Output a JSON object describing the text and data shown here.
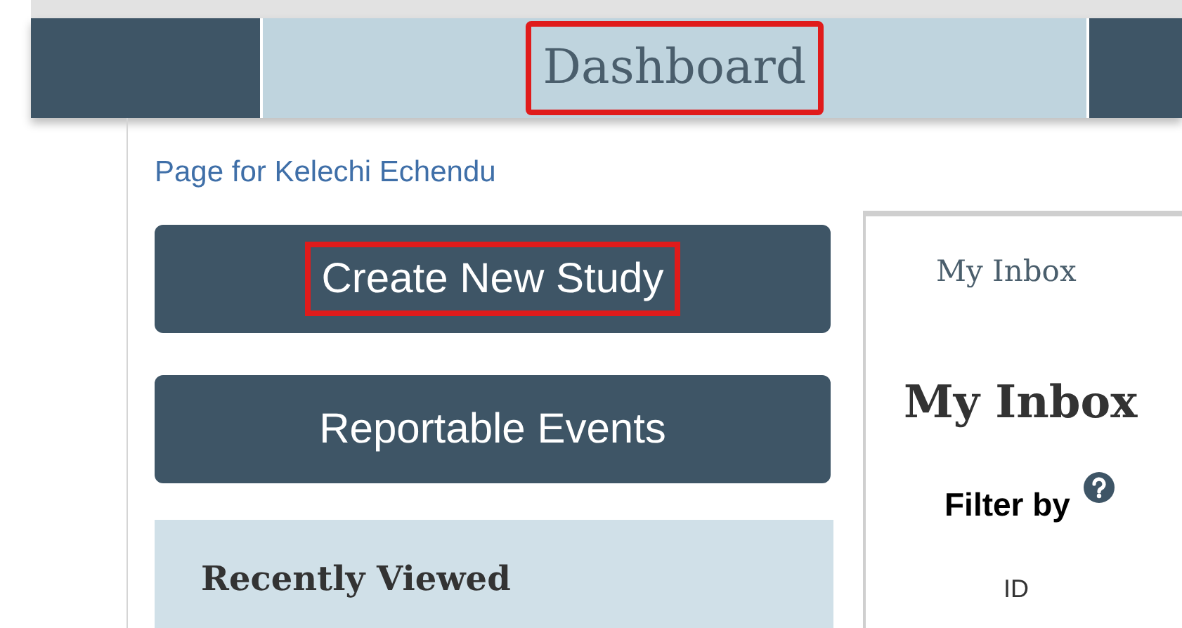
{
  "nav": {
    "tabs": [
      {
        "label": "Dashboard",
        "selected": true,
        "highlighted": true
      }
    ]
  },
  "page_title": "Page for Kelechi Echendu",
  "actions": [
    {
      "label": "Create New Study",
      "highlighted": true
    },
    {
      "label": "Reportable Events",
      "highlighted": false
    }
  ],
  "recently_viewed": {
    "title": "Recently Viewed"
  },
  "inbox": {
    "tab": "My Inbox",
    "title": "My Inbox",
    "filter_label": "Filter by",
    "column_1": "ID"
  }
}
